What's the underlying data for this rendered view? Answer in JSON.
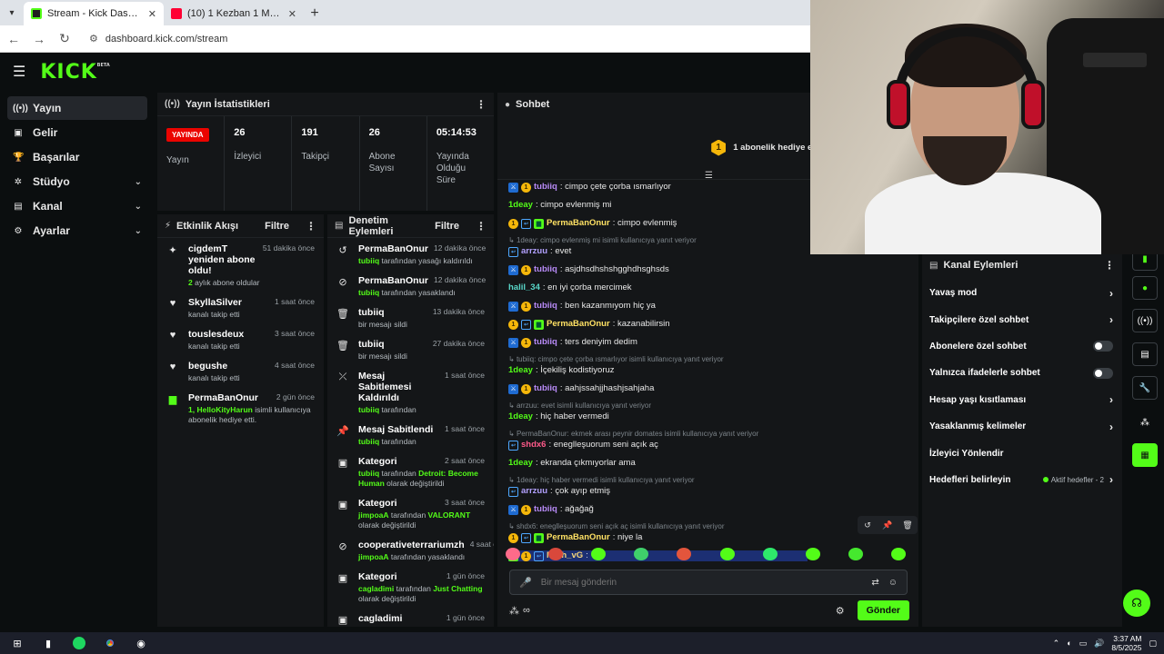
{
  "browser": {
    "tabs": [
      {
        "title": "Stream - Kick Dashboard",
        "active": true
      },
      {
        "title": "(10) 1 Kezban 1 Mahmut | 7. Bö",
        "active": false
      }
    ],
    "url": "dashboard.kick.com/stream"
  },
  "brand": {
    "logo": "KICK",
    "beta": "BETA"
  },
  "sidebar": {
    "items": [
      {
        "label": "Yayın",
        "icon": "broadcast-icon"
      },
      {
        "label": "Gelir",
        "icon": "wallet-icon"
      },
      {
        "label": "Başarılar",
        "icon": "trophy-icon"
      },
      {
        "label": "Stüdyo",
        "icon": "studio-icon"
      },
      {
        "label": "Kanal",
        "icon": "channel-icon"
      },
      {
        "label": "Ayarlar",
        "icon": "gear-icon"
      }
    ]
  },
  "stats": {
    "title": "Yayın İstatistikleri",
    "live_badge": "YAYINDA",
    "live_label": "Yayın",
    "cells": [
      {
        "value": "26",
        "label": "İzleyici"
      },
      {
        "value": "191",
        "label": "Takipçi"
      },
      {
        "value": "26",
        "label": "Abone Sayısı"
      },
      {
        "value": "05:14:53",
        "label": "Yayında Olduğu Süre"
      }
    ]
  },
  "activity": {
    "title": "Etkinlik Akışı",
    "filter": "Filtre",
    "items": [
      {
        "name": "cigdemT yeniden abone oldu!",
        "time": "51 dakika önce",
        "desc_green": "2",
        "desc": " aylık abone oldular"
      },
      {
        "name": "SkyllaSilver",
        "time": "1 saat önce",
        "desc_green": "",
        "desc": "kanalı takip etti"
      },
      {
        "name": "touslesdeux",
        "time": "3 saat önce",
        "desc_green": "",
        "desc": "kanalı takip etti"
      },
      {
        "name": "begushe",
        "time": "4 saat önce",
        "desc_green": "",
        "desc": "kanalı takip etti"
      },
      {
        "name": "PermaBanOnur",
        "time": "2 gün önce",
        "desc_green": "1, HelloKityHarun",
        "desc": " isimli kullanıcıya abonelik hediye etti."
      }
    ]
  },
  "moderation": {
    "title": "Denetim Eylemleri",
    "filter": "Filtre",
    "items": [
      {
        "name": "PermaBanOnur",
        "time": "12 dakika önce",
        "g1": "tubiiq",
        "d1": " tarafından yasağı kaldırıldı",
        "g2": "",
        "d2": ""
      },
      {
        "name": "PermaBanOnur",
        "time": "12 dakika önce",
        "g1": "tubiiq",
        "d1": " tarafından yasaklandı",
        "g2": "",
        "d2": ""
      },
      {
        "name": "tubiiq",
        "time": "13 dakika önce",
        "g1": "",
        "d1": "bir mesajı sildi",
        "g2": "",
        "d2": ""
      },
      {
        "name": "tubiiq",
        "time": "27 dakika önce",
        "g1": "",
        "d1": "bir mesajı sildi",
        "g2": "",
        "d2": ""
      },
      {
        "name": "Mesaj Sabitlemesi Kaldırıldı",
        "time": "1 saat önce",
        "g1": "tubiiq",
        "d1": " tarafından",
        "g2": "",
        "d2": ""
      },
      {
        "name": "Mesaj Sabitlendi",
        "time": "1 saat önce",
        "g1": "tubiiq",
        "d1": " tarafından",
        "g2": "",
        "d2": ""
      },
      {
        "name": "Kategori",
        "time": "2 saat önce",
        "g1": "tubiiq",
        "d1": " tarafından ",
        "g2": "Detroit: Become Human",
        "d2": " olarak değiştirildi"
      },
      {
        "name": "Kategori",
        "time": "3 saat önce",
        "g1": "jimpoaA",
        "d1": " tarafından ",
        "g2": "VALORANT",
        "d2": " olarak değiştirildi"
      },
      {
        "name": "cooperativeterrariumzh",
        "time": "4 saat önce",
        "g1": "jimpoaA",
        "d1": " tarafından yasaklandı",
        "g2": "",
        "d2": ""
      },
      {
        "name": "Kategori",
        "time": "1 gün önce",
        "g1": "cagladimi",
        "d1": " tarafından ",
        "g2": "Just Chatting",
        "d2": " olarak değiştirildi"
      },
      {
        "name": "cagladimi",
        "time": "1 gün önce",
        "g1": "",
        "d1": "",
        "g2": "",
        "d2": ""
      }
    ]
  },
  "chat": {
    "title": "Sohbet",
    "pinned_badge": "1",
    "pinned_text": "1 abonelik hediye ederek 1. sıraya yükselin",
    "messages": [
      {
        "reply": "",
        "user": "tubiiq",
        "text": ": cimpo çete çorba ısmarlıyor"
      },
      {
        "reply": "",
        "user": "1deay",
        "text": ": cimpo evlenmiş mi"
      },
      {
        "reply": "",
        "user": "PermaBanOnur",
        "text": ": cimpo evlenmiş"
      },
      {
        "reply": "1deay: cimpo evlenmiş mi isimli kullanıcıya yanıt veriyor",
        "user": "arrzuu",
        "text": ": evet"
      },
      {
        "reply": "",
        "user": "tubiiq",
        "text": ": asjdhsdhshshgghdhsghsds"
      },
      {
        "reply": "",
        "user": "halil_34",
        "text": ": en iyi çorba mercimek"
      },
      {
        "reply": "",
        "user": "tubiiq",
        "text": ": ben kazanmıyom hiç ya"
      },
      {
        "reply": "",
        "user": "PermaBanOnur",
        "text": ": kazanabilirsin"
      },
      {
        "reply": "",
        "user": "tubiiq",
        "text": ": ters deniyim dedim"
      },
      {
        "reply": "tubiiq: cimpo çete çorba ısmarlıyor isimli kullanıcıya yanıt veriyor",
        "user": "1deay",
        "text": ": İçekiliş kodistiyoruz"
      },
      {
        "reply": "",
        "user": "tubiiq",
        "text": ": aahjssahjjhashjsahjaha"
      },
      {
        "reply": "arrzuu: evet isimli kullanıcıya yanıt veriyor",
        "user": "1deay",
        "text": ": hiç haber vermedi"
      },
      {
        "reply": "PermaBanOnur: ekmek arası peynir domates isimli kullanıcıya yanıt veriyor",
        "user": "shdx6",
        "text": ": eneglleşuorum seni açık aç"
      },
      {
        "reply": "",
        "user": "1deay",
        "text": ": ekranda çıkmıyorlar ama"
      },
      {
        "reply": "1deay: hiç haber vermedi isimli kullanıcıya yanıt veriyor",
        "user": "arrzuu",
        "text": ": çok ayıp etmiş"
      },
      {
        "reply": "",
        "user": "tubiiq",
        "text": ": ağağağ"
      },
      {
        "reply": "shdx6: eneglleşuorum seni açık aç isimli kullanıcıya yanıt veriyor",
        "user": "PermaBanOnur",
        "text": ": niye la"
      },
      {
        "reply": "",
        "user": "Myth_vG",
        "text": ": "
      }
    ],
    "input_placeholder": "Bir mesaj gönderin",
    "send_label": "Gönder"
  },
  "channel_actions": {
    "title": "Kanal Eylemleri",
    "items": [
      {
        "label": "Yavaş mod",
        "kind": "chevron"
      },
      {
        "label": "Takipçilere özel sohbet",
        "kind": "chevron"
      },
      {
        "label": "Abonelere özel sohbet",
        "kind": "toggle"
      },
      {
        "label": "Yalnızca ifadelerle sohbet",
        "kind": "toggle"
      },
      {
        "label": "Hesap yaşı kısıtlaması",
        "kind": "chevron"
      },
      {
        "label": "Yasaklanmış kelimeler",
        "kind": "chevron"
      },
      {
        "label": "İzleyici Yönlendir",
        "kind": "none"
      },
      {
        "label": "Hedefleri belirleyin",
        "kind": "goal",
        "value": "Aktif hedefler - 2"
      }
    ]
  },
  "taskbar": {
    "time": "3:37 AM",
    "date": "8/5/2025"
  },
  "colors": {
    "accent": "#53fc18",
    "live": "#eb0400",
    "panel": "#141618",
    "bg": "#0b0e0f"
  }
}
